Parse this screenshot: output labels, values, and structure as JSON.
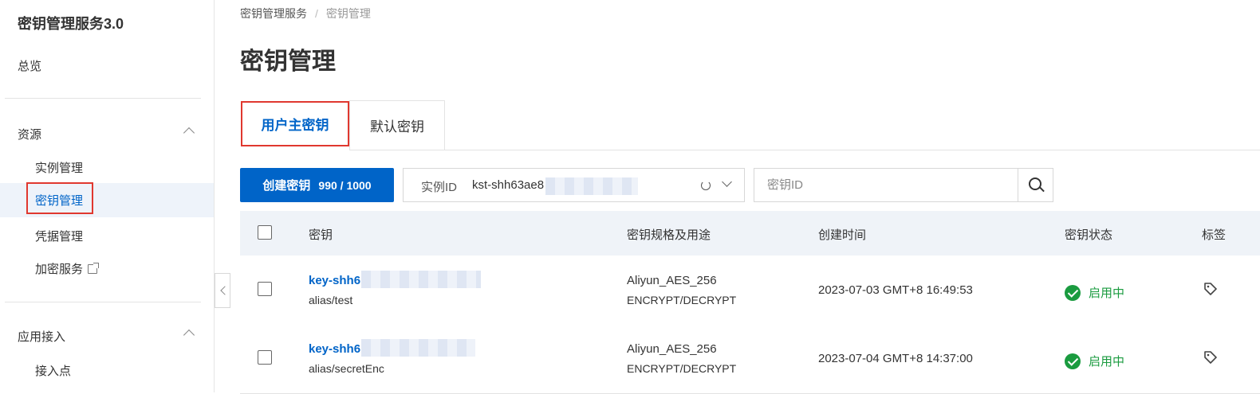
{
  "sidebar": {
    "title": "密钥管理服务3.0",
    "overview": "总览",
    "groups": [
      {
        "label": "资源",
        "items": [
          {
            "label": "实例管理"
          },
          {
            "label": "密钥管理",
            "active": true
          },
          {
            "label": "凭据管理"
          },
          {
            "label": "加密服务",
            "external": true
          }
        ]
      },
      {
        "label": "应用接入",
        "items": [
          {
            "label": "接入点"
          }
        ]
      }
    ]
  },
  "breadcrumb": {
    "root": "密钥管理服务",
    "separator": "/",
    "current": "密钥管理"
  },
  "page": {
    "title": "密钥管理"
  },
  "tabs": [
    {
      "label": "用户主密钥",
      "active": true
    },
    {
      "label": "默认密钥",
      "active": false
    }
  ],
  "toolbar": {
    "create_label": "创建密钥",
    "create_count": "990 / 1000",
    "instance_key": "实例ID",
    "instance_value": "kst-shh63ae8",
    "search_placeholder": "密钥ID"
  },
  "table": {
    "columns": [
      "密钥",
      "密钥规格及用途",
      "创建时间",
      "密钥状态",
      "标签"
    ],
    "rows": [
      {
        "key_id": "key-shh6",
        "alias": "alias/test",
        "spec": "Aliyun_AES_256",
        "usage": "ENCRYPT/DECRYPT",
        "created": "2023-07-03 GMT+8 16:49:53",
        "status": "启用中"
      },
      {
        "key_id": "key-shh6",
        "alias": "alias/secretEnc",
        "spec": "Aliyun_AES_256",
        "usage": "ENCRYPT/DECRYPT",
        "created": "2023-07-04 GMT+8 14:37:00",
        "status": "启用中"
      }
    ]
  },
  "colors": {
    "primary": "#0064c8",
    "highlight_box": "#e0382f",
    "status_ok": "#1a9b3f",
    "header_bg": "#eff3f8"
  },
  "icons": [
    "chevron-up-icon",
    "external-link-icon",
    "refresh-icon",
    "chevron-down-icon",
    "search-icon",
    "check-circle-icon",
    "tag-icon",
    "collapse-sidebar-icon"
  ]
}
